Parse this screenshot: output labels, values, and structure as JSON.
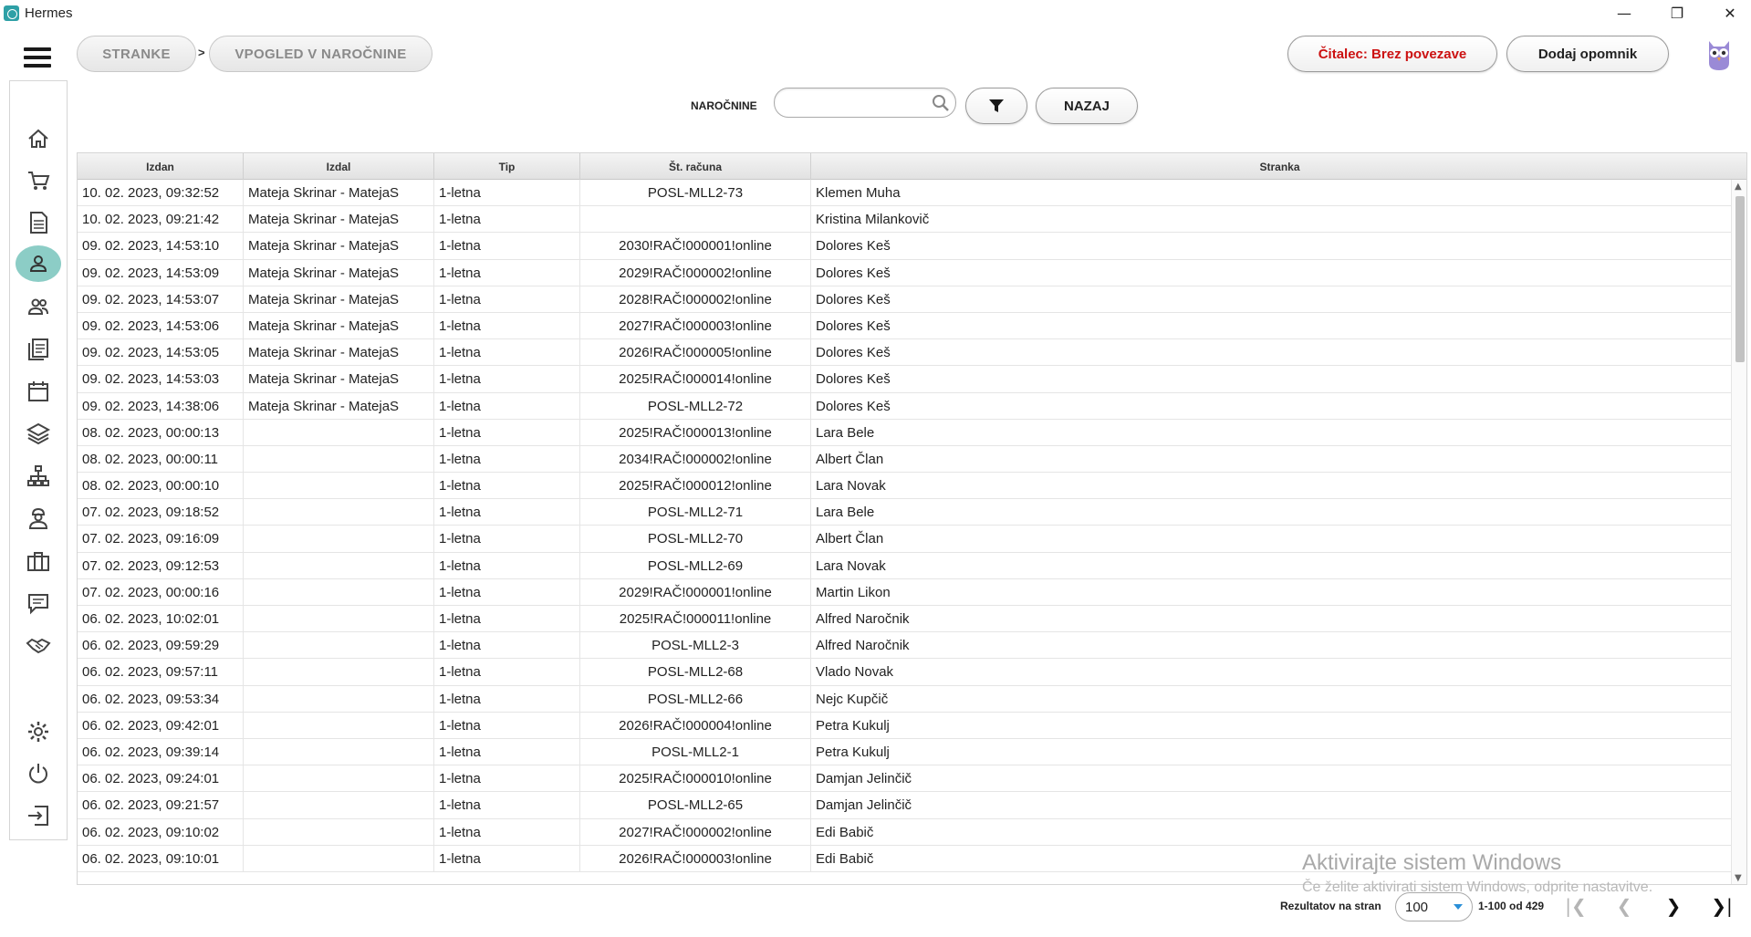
{
  "window": {
    "title": "Hermes",
    "controls": [
      "minimize",
      "restore",
      "close"
    ]
  },
  "breadcrumb": {
    "items": [
      "STRANKE",
      "VPOGLED V NAROČNINE"
    ],
    "separator": ">"
  },
  "header": {
    "reader_button": "Čitalec: Brez povezave",
    "reminder_button": "Dodaj opomnik",
    "reader_color": "#cc1111"
  },
  "sidebar": {
    "active_color": "#8ccdc6",
    "items": [
      {
        "icon": "home-icon"
      },
      {
        "icon": "cart-icon"
      },
      {
        "icon": "document-icon"
      },
      {
        "icon": "person-icon",
        "active": true
      },
      {
        "icon": "people-icon"
      },
      {
        "icon": "list-icon"
      },
      {
        "icon": "calendar-icon"
      },
      {
        "icon": "layers-icon"
      },
      {
        "icon": "network-icon"
      },
      {
        "icon": "worker-icon"
      },
      {
        "icon": "briefcase-icon"
      },
      {
        "icon": "chat-icon"
      },
      {
        "icon": "handshake-icon"
      },
      {
        "icon": "gear-icon"
      },
      {
        "icon": "power-icon"
      },
      {
        "icon": "logout-icon"
      }
    ]
  },
  "filter": {
    "label": "NAROČNINE",
    "search_value": "",
    "back_button": "NAZAJ"
  },
  "table": {
    "columns": [
      "Izdan",
      "Izdal",
      "Tip",
      "Št. računa",
      "Stranka"
    ],
    "rows": [
      [
        "10. 02. 2023, 09:32:52",
        "Mateja Skrinar - MatejaS",
        "1-letna",
        "POSL-MLL2-73",
        "Klemen Muha"
      ],
      [
        "10. 02. 2023, 09:21:42",
        "Mateja Skrinar - MatejaS",
        "1-letna",
        "",
        "Kristina Milankovič"
      ],
      [
        "09. 02. 2023, 14:53:10",
        "Mateja Skrinar - MatejaS",
        "1-letna",
        "2030!RAČ!000001!online",
        "Dolores Keš"
      ],
      [
        "09. 02. 2023, 14:53:09",
        "Mateja Skrinar - MatejaS",
        "1-letna",
        "2029!RAČ!000002!online",
        "Dolores Keš"
      ],
      [
        "09. 02. 2023, 14:53:07",
        "Mateja Skrinar - MatejaS",
        "1-letna",
        "2028!RAČ!000002!online",
        "Dolores Keš"
      ],
      [
        "09. 02. 2023, 14:53:06",
        "Mateja Skrinar - MatejaS",
        "1-letna",
        "2027!RAČ!000003!online",
        "Dolores Keš"
      ],
      [
        "09. 02. 2023, 14:53:05",
        "Mateja Skrinar - MatejaS",
        "1-letna",
        "2026!RAČ!000005!online",
        "Dolores Keš"
      ],
      [
        "09. 02. 2023, 14:53:03",
        "Mateja Skrinar - MatejaS",
        "1-letna",
        "2025!RAČ!000014!online",
        "Dolores Keš"
      ],
      [
        "09. 02. 2023, 14:38:06",
        "Mateja Skrinar - MatejaS",
        "1-letna",
        "POSL-MLL2-72",
        "Dolores Keš"
      ],
      [
        "08. 02. 2023, 00:00:13",
        "",
        "1-letna",
        "2025!RAČ!000013!online",
        "Lara Bele"
      ],
      [
        "08. 02. 2023, 00:00:11",
        "",
        "1-letna",
        "2034!RAČ!000002!online",
        "Albert Član"
      ],
      [
        "08. 02. 2023, 00:00:10",
        "",
        "1-letna",
        "2025!RAČ!000012!online",
        "Lara Novak"
      ],
      [
        "07. 02. 2023, 09:18:52",
        "",
        "1-letna",
        "POSL-MLL2-71",
        "Lara Bele"
      ],
      [
        "07. 02. 2023, 09:16:09",
        "",
        "1-letna",
        "POSL-MLL2-70",
        "Albert Član"
      ],
      [
        "07. 02. 2023, 09:12:53",
        "",
        "1-letna",
        "POSL-MLL2-69",
        "Lara Novak"
      ],
      [
        "07. 02. 2023, 00:00:16",
        "",
        "1-letna",
        "2029!RAČ!000001!online",
        "Martin Likon"
      ],
      [
        "06. 02. 2023, 10:02:01",
        "",
        "1-letna",
        "2025!RAČ!000011!online",
        "Alfred Naročnik"
      ],
      [
        "06. 02. 2023, 09:59:29",
        "",
        "1-letna",
        "POSL-MLL2-3",
        "Alfred Naročnik"
      ],
      [
        "06. 02. 2023, 09:57:11",
        "",
        "1-letna",
        "POSL-MLL2-68",
        "Vlado Novak"
      ],
      [
        "06. 02. 2023, 09:53:34",
        "",
        "1-letna",
        "POSL-MLL2-66",
        "Nejc Kupčič"
      ],
      [
        "06. 02. 2023, 09:42:01",
        "",
        "1-letna",
        "2026!RAČ!000004!online",
        "Petra Kukulj"
      ],
      [
        "06. 02. 2023, 09:39:14",
        "",
        "1-letna",
        "POSL-MLL2-1",
        "Petra Kukulj"
      ],
      [
        "06. 02. 2023, 09:24:01",
        "",
        "1-letna",
        "2025!RAČ!000010!online",
        "Damjan Jelinčič"
      ],
      [
        "06. 02. 2023, 09:21:57",
        "",
        "1-letna",
        "POSL-MLL2-65",
        "Damjan Jelinčič"
      ],
      [
        "06. 02. 2023, 09:10:02",
        "",
        "1-letna",
        "2027!RAČ!000002!online",
        "Edi Babič"
      ],
      [
        "06. 02. 2023, 09:10:01",
        "",
        "1-letna",
        "2026!RAČ!000003!online",
        "Edi Babič"
      ]
    ]
  },
  "watermark": {
    "line1": "Aktivirajte sistem Windows",
    "line2": "Če želite aktivirati sistem Windows, odprite nastavitve."
  },
  "pagination": {
    "label": "Rezultatov na stran",
    "per_page": "100",
    "range": "1-100 od 429"
  }
}
